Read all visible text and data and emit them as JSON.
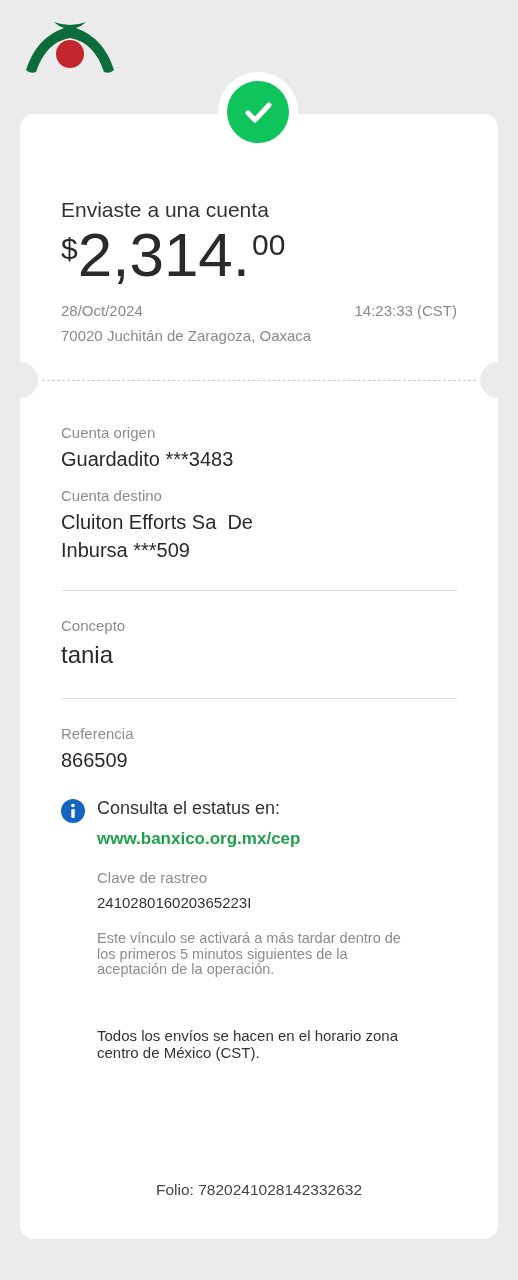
{
  "header": {
    "title": "Enviaste a una cuenta",
    "amount": {
      "currency": "$",
      "whole": "2,314.",
      "cents": "00"
    },
    "date": "28/Oct/2024",
    "time": "14:23:33 (CST)",
    "location": "70020 Juchitán de Zaragoza, Oaxaca"
  },
  "sections": [
    {
      "fields": [
        {
          "label": "Cuenta origen",
          "value": "Guardadito ***3483",
          "kind": "normal"
        },
        {
          "label": "Cuenta destino",
          "value": "Cluiton Efforts Sa  De\nInbursa ***509",
          "kind": "normal"
        }
      ]
    },
    {
      "fields": [
        {
          "label": "Concepto",
          "value": "tania",
          "kind": "large"
        }
      ]
    },
    {
      "fields": [
        {
          "label": "Referencia",
          "value": "866509",
          "kind": "normal"
        }
      ]
    }
  ],
  "info": {
    "heading": "Consulta el estatus en:",
    "link": "www.banxico.org.mx/cep",
    "tracking_label": "Clave de rastreo",
    "tracking_value": "241028016020365223I",
    "note": "Este vínculo se activará a más tardar dentro de los primeros 5 minutos siguientes de la aceptación de la operación.",
    "timezone_note": "Todos los envíos se hacen en el horario zona centro de México (CST)."
  },
  "folio": "Folio: 7820241028142332632"
}
